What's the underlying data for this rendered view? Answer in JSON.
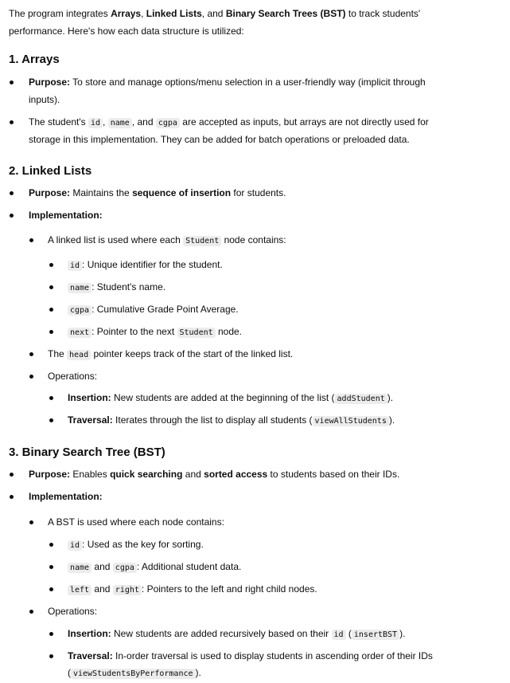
{
  "intro": {
    "t1": "The program integrates ",
    "arrays": "Arrays",
    "t2": ", ",
    "linked": "Linked Lists",
    "t3": ", and ",
    "bst": "Binary Search Trees (BST)",
    "t4": " to track students'",
    "line2": "performance. Here's how each data structure is utilized:"
  },
  "s1": {
    "heading": "1. Arrays",
    "b1": {
      "label": "Purpose:",
      "text": " To store and manage options/menu selection in a user-friendly way (implicit through",
      "line2": "inputs)."
    },
    "b2": {
      "t1": "The student's ",
      "c1": "id",
      "t2": ", ",
      "c2": "name",
      "t3": ", and ",
      "c3": "cgpa",
      "t4": " are accepted as inputs, but arrays are not directly used for",
      "line2": "storage in this implementation. They can be added for batch operations or preloaded data."
    }
  },
  "s2": {
    "heading": "2. Linked Lists",
    "purpose": {
      "label": "Purpose:",
      "t1": " Maintains the ",
      "bold": "sequence of insertion",
      "t2": " for students."
    },
    "impl": "Implementation:",
    "node": {
      "t1": "A linked list is used where each ",
      "code": "Student",
      "t2": " node contains:"
    },
    "fields": [
      {
        "code": "id",
        "text": ": Unique identifier for the student."
      },
      {
        "code": "name",
        "text": ": Student's name."
      },
      {
        "code": "cgpa",
        "text": ": Cumulative Grade Point Average."
      },
      {
        "code": "next",
        "text": ": Pointer to the next ",
        "code2": "Student",
        "text2": " node."
      }
    ],
    "head": {
      "t1": "The ",
      "code": "head",
      "t2": " pointer keeps track of the start of the linked list."
    },
    "ops": "Operations:",
    "insertion": {
      "label": "Insertion:",
      "text": " New students are added at the beginning of the list (",
      "code": "addStudent",
      "end": ")."
    },
    "traversal": {
      "label": "Traversal:",
      "text": " Iterates through the list to display all students (",
      "code": "viewAllStudents",
      "end": ")."
    }
  },
  "s3": {
    "heading": "3. Binary Search Tree (BST)",
    "purpose": {
      "label": "Purpose:",
      "t1": " Enables ",
      "b1": "quick searching",
      "t2": " and ",
      "b2": "sorted access",
      "t3": " to students based on their IDs."
    },
    "impl": "Implementation:",
    "node": "A BST is used where each node contains:",
    "f1": {
      "code": "id",
      "text": ": Used as the key for sorting."
    },
    "f2": {
      "code": "name",
      "t1": " and ",
      "code2": "cgpa",
      "text": ": Additional student data."
    },
    "f3": {
      "code": "left",
      "t1": " and ",
      "code2": "right",
      "text": ": Pointers to the left and right child nodes."
    },
    "ops": "Operations:",
    "insertion": {
      "label": "Insertion:",
      "text": " New students are added recursively based on their ",
      "code": "id",
      "mid": " (",
      "code2": "insertBST",
      "end": ")."
    },
    "traversal": {
      "label": "Traversal:",
      "text": " In-order traversal is used to display students in ascending order of their IDs",
      "l2pre": "(",
      "code": "viewStudentsByPerformance",
      "end": ")."
    }
  }
}
